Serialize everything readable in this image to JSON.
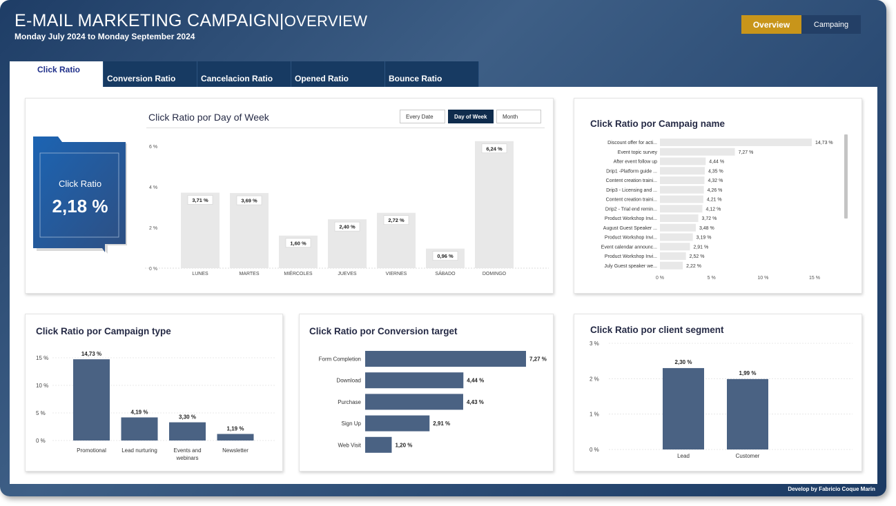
{
  "header": {
    "title_main": "E-MAIL MARKETING CAMPAIGN|",
    "title_sub": "OVERVIEW",
    "date_range": "Monday July  2024 to Monday September 2024",
    "nav": {
      "overview": "Overview",
      "campaing": "Campaing"
    }
  },
  "tabs": [
    {
      "label": "Click Ratio"
    },
    {
      "label": "Conversion Ratio"
    },
    {
      "label": "Cancelacion Ratio"
    },
    {
      "label": "Opened Ratio"
    },
    {
      "label": "Bounce Ratio"
    }
  ],
  "kpi": {
    "label": "Click Ratio",
    "value": "2,18 %"
  },
  "segments": {
    "every_date": "Every Date",
    "day_of_week": "Day of Week",
    "month": "Month"
  },
  "colors": {
    "accent": "#c8951a",
    "dark_navy": "#0f2c4d",
    "bar_grey": "#e8e8e8",
    "bar_blue": "#4a6283"
  },
  "chart_data": [
    {
      "id": "day_of_week",
      "type": "bar",
      "title": "Click Ratio por Day of Week",
      "categories": [
        "LUNES",
        "MARTES",
        "MIÉRCOLES",
        "JUEVES",
        "VIERNES",
        "SÁBADO",
        "DOMINGO"
      ],
      "values": [
        3.71,
        3.69,
        1.6,
        2.4,
        2.72,
        0.96,
        6.24
      ],
      "labels": [
        "3,71 %",
        "3,69 %",
        "1,60 %",
        "2,40 %",
        "2,72 %",
        "0,96 %",
        "6,24 %"
      ],
      "yticks": [
        "6 %",
        "4 %",
        "2 %",
        "0 %"
      ],
      "ytick_values": [
        6,
        4,
        2,
        0
      ],
      "ylim": [
        0,
        6.3
      ]
    },
    {
      "id": "campaign_name",
      "type": "bar",
      "orientation": "horizontal",
      "title": "Click Ratio por Campaig name",
      "categories": [
        "Discount offer for acti...",
        "Event topic survey",
        "After event follow up",
        "Drip1 -Platform guide ...",
        "Content creation traini...",
        "Drip3 - Licensing and ...",
        "Content creation traini...",
        "Drip2 - Trial end remin...",
        "Product Workshop Invi...",
        "August Guest Speaker ...",
        "Product Workshop Invi...",
        "Event calendar announc...",
        "Product Workshop Invi...",
        "July Guest speaker we..."
      ],
      "values": [
        14.73,
        7.27,
        4.44,
        4.35,
        4.32,
        4.26,
        4.21,
        4.12,
        3.72,
        3.48,
        3.19,
        2.91,
        2.52,
        2.22
      ],
      "labels": [
        "14,73 %",
        "7,27 %",
        "4,44 %",
        "4,35 %",
        "4,32 %",
        "4,26 %",
        "4,21 %",
        "4,12 %",
        "3,72 %",
        "3,48 %",
        "3,19 %",
        "2,91 %",
        "2,52 %",
        "2,22 %"
      ],
      "xticks": [
        "0 %",
        "5 %",
        "10 %",
        "15 %"
      ],
      "xtick_values": [
        0,
        5,
        10,
        15
      ],
      "xlim": [
        0,
        15
      ]
    },
    {
      "id": "campaign_type",
      "type": "bar",
      "title": "Click Ratio por Campaign type",
      "categories": [
        [
          "Promotional"
        ],
        [
          "Lead nurturing"
        ],
        [
          "Events and",
          "webinars"
        ],
        [
          "Newsletter"
        ]
      ],
      "values": [
        14.73,
        4.19,
        3.3,
        1.19
      ],
      "labels": [
        "14,73 %",
        "4,19 %",
        "3,30 %",
        "1,19 %"
      ],
      "yticks": [
        "15 %",
        "10 %",
        "5 %",
        "0 %"
      ],
      "ytick_values": [
        15,
        10,
        5,
        0
      ],
      "ylim": [
        0,
        15
      ]
    },
    {
      "id": "conversion_target",
      "type": "bar",
      "orientation": "horizontal",
      "title": "Click Ratio por Conversion target",
      "categories": [
        "Form Completion",
        "Download",
        "Purchase",
        "Sign Up",
        "Web Visit"
      ],
      "values": [
        7.27,
        4.44,
        4.43,
        2.91,
        1.2
      ],
      "labels": [
        "7,27 %",
        "4,44 %",
        "4,43 %",
        "2,91 %",
        "1,20 %"
      ],
      "xlim": [
        0,
        7.27
      ]
    },
    {
      "id": "client_segment",
      "type": "bar",
      "title": "Click Ratio por client segment",
      "categories": [
        "Lead",
        "Customer"
      ],
      "values": [
        2.3,
        1.99
      ],
      "labels": [
        "2,30 %",
        "1,99 %"
      ],
      "yticks": [
        "3 %",
        "2 %",
        "1 %",
        "0 %"
      ],
      "ytick_values": [
        3,
        2,
        1,
        0
      ],
      "ylim": [
        0,
        3
      ]
    }
  ],
  "footer": {
    "credit": "Develop by Fabricio Coque Marin"
  }
}
